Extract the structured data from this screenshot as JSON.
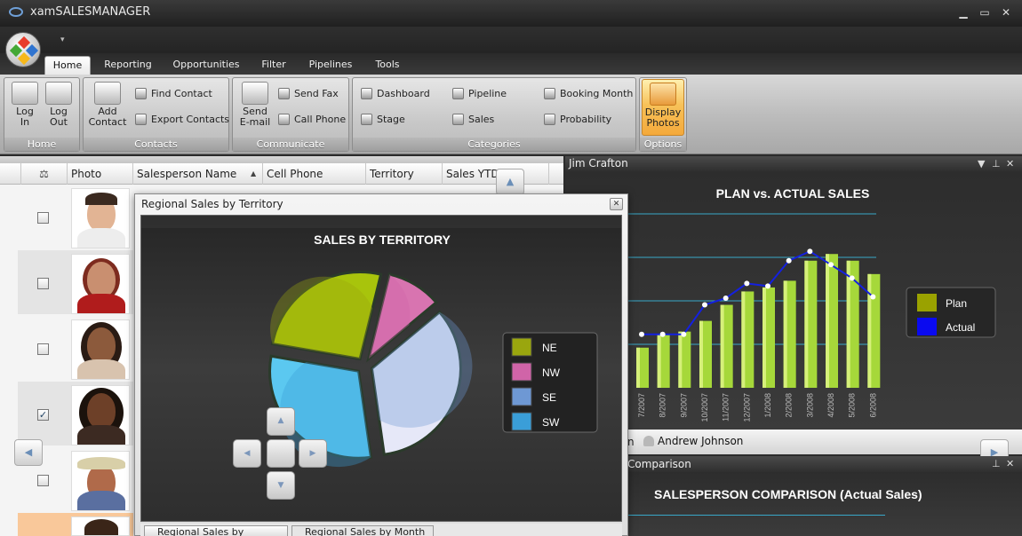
{
  "window": {
    "title": "xamSALESMANAGER",
    "controls": [
      "▁",
      "▭",
      "✕"
    ]
  },
  "ribbon": {
    "tabs": [
      {
        "label": "Home",
        "active": true
      },
      {
        "label": "Reporting"
      },
      {
        "label": "Opportunities"
      },
      {
        "label": "Filter"
      },
      {
        "label": "Pipelines"
      },
      {
        "label": "Tools"
      }
    ],
    "groups": {
      "home": {
        "caption": "Home",
        "login": "Log\nIn",
        "login_l1": "Log",
        "login_l2": "In",
        "logout_l1": "Log",
        "logout_l2": "Out"
      },
      "contacts": {
        "caption": "Contacts",
        "add_l1": "Add",
        "add_l2": "Contact",
        "find": "Find Contact",
        "export": "Export Contacts"
      },
      "communicate": {
        "caption": "Communicate",
        "email_l1": "Send",
        "email_l2": "E-mail",
        "fax": "Send Fax",
        "phone": "Call Phone"
      },
      "categories": {
        "caption": "Categories",
        "dashboard": "Dashboard",
        "stage": "Stage",
        "pipeline": "Pipeline",
        "sales": "Sales",
        "booking": "Booking Month",
        "probability": "Probability"
      },
      "options": {
        "caption": "Options",
        "photos_l1": "Display",
        "photos_l2": "Photos"
      }
    }
  },
  "grid": {
    "columns": [
      "Photo",
      "Salesperson Name",
      "Cell Phone",
      "Territory",
      "Sales YTD"
    ],
    "scale_icon": "⚖",
    "rows": [
      {
        "checked": false
      },
      {
        "checked": false
      },
      {
        "checked": false
      },
      {
        "checked": true
      },
      {
        "checked": false
      }
    ]
  },
  "dialog": {
    "title": "Regional Sales by Territory",
    "chart_title": "SALES BY TERRITORY",
    "tabs": [
      "Regional Sales by Territory",
      "Regional Sales by Month"
    ],
    "legend": [
      {
        "label": "NE",
        "color": "#9aa60e"
      },
      {
        "label": "NW",
        "color": "#d064a8"
      },
      {
        "label": "SE",
        "color": "#6e98d4"
      },
      {
        "label": "SW",
        "color": "#3a9ed8"
      }
    ]
  },
  "right_pane": {
    "header": "Jim Crafton",
    "tab_partial": "n",
    "tab_person": "Andrew Johnson",
    "lower_header": "Comparison",
    "lower_title": "SALESPERSON COMPARISON (Actual Sales)"
  },
  "chart_data": [
    {
      "type": "pie",
      "title": "SALES BY TERRITORY",
      "categories": [
        "NE",
        "NW",
        "SE",
        "SW"
      ],
      "values": [
        26,
        10,
        34,
        30
      ],
      "legend": "right"
    },
    {
      "type": "bar",
      "title": "PLAN vs. ACTUAL SALES",
      "categories": [
        "7/2007",
        "8/2007",
        "9/2007",
        "10/2007",
        "11/2007",
        "12/2007",
        "1/2008",
        "2/2008",
        "3/2008",
        "4/2008",
        "5/2008",
        "6/2008"
      ],
      "series": [
        {
          "name": "Plan",
          "values": [
            30,
            40,
            42,
            50,
            62,
            72,
            75,
            80,
            95,
            100,
            95,
            85
          ]
        },
        {
          "name": "Actual",
          "values": [
            40,
            40,
            40,
            62,
            67,
            78,
            76,
            95,
            102,
            92,
            82,
            68
          ]
        }
      ],
      "legend": "right",
      "grid": true,
      "ylim": [
        0,
        130
      ]
    }
  ]
}
